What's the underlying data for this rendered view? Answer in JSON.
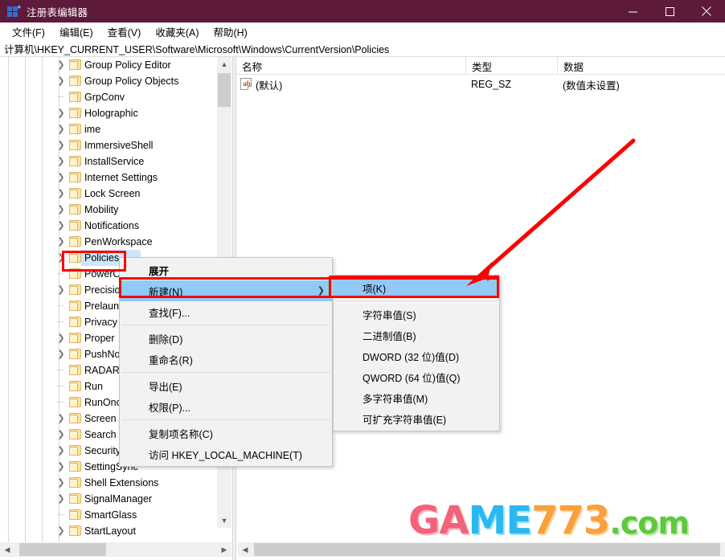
{
  "window": {
    "title": "注册表编辑器",
    "icon": "registry-editor-icon",
    "titlebar_color": "#5d1a3b",
    "minimize_label": "—",
    "maximize_label": "▢",
    "close_label": "✕"
  },
  "menubar": {
    "items": [
      {
        "label": "文件(F)"
      },
      {
        "label": "编辑(E)"
      },
      {
        "label": "查看(V)"
      },
      {
        "label": "收藏夹(A)"
      },
      {
        "label": "帮助(H)"
      }
    ]
  },
  "address": {
    "path": "计算机\\HKEY_CURRENT_USER\\Software\\Microsoft\\Windows\\CurrentVersion\\Policies"
  },
  "tree": {
    "items": [
      {
        "label": "Group Policy Editor",
        "expandable": true,
        "selected": false
      },
      {
        "label": "Group Policy Objects",
        "expandable": true,
        "selected": false
      },
      {
        "label": "GrpConv",
        "expandable": false,
        "selected": false
      },
      {
        "label": "Holographic",
        "expandable": true,
        "selected": false
      },
      {
        "label": "ime",
        "expandable": true,
        "selected": false
      },
      {
        "label": "ImmersiveShell",
        "expandable": true,
        "selected": false
      },
      {
        "label": "InstallService",
        "expandable": true,
        "selected": false
      },
      {
        "label": "Internet Settings",
        "expandable": true,
        "selected": false
      },
      {
        "label": "Lock Screen",
        "expandable": true,
        "selected": false
      },
      {
        "label": "Mobility",
        "expandable": true,
        "selected": false
      },
      {
        "label": "Notifications",
        "expandable": true,
        "selected": false
      },
      {
        "label": "PenWorkspace",
        "expandable": true,
        "selected": false
      },
      {
        "label": "Policies",
        "expandable": true,
        "selected": true
      },
      {
        "label": "PowerConfiguration",
        "expandable": false,
        "selected": false
      },
      {
        "label": "Precision Touchpad",
        "expandable": true,
        "selected": false
      },
      {
        "label": "Prelaunch",
        "expandable": false,
        "selected": false
      },
      {
        "label": "Privacy",
        "expandable": false,
        "selected": false
      },
      {
        "label": "Proper",
        "expandable": true,
        "selected": false
      },
      {
        "label": "PushNotifications",
        "expandable": true,
        "selected": false
      },
      {
        "label": "RADAR",
        "expandable": false,
        "selected": false
      },
      {
        "label": "Run",
        "expandable": false,
        "selected": false
      },
      {
        "label": "RunOnce",
        "expandable": false,
        "selected": false
      },
      {
        "label": "Screen",
        "expandable": true,
        "selected": false
      },
      {
        "label": "Search",
        "expandable": true,
        "selected": false
      },
      {
        "label": "Security and Maintenance",
        "expandable": true,
        "selected": false
      },
      {
        "label": "SettingSync",
        "expandable": true,
        "selected": false
      },
      {
        "label": "Shell Extensions",
        "expandable": true,
        "selected": false
      },
      {
        "label": "SignalManager",
        "expandable": true,
        "selected": false
      },
      {
        "label": "SmartGlass",
        "expandable": false,
        "selected": false
      },
      {
        "label": "StartLayout",
        "expandable": true,
        "selected": false
      }
    ]
  },
  "listview": {
    "columns": [
      {
        "label": "名称"
      },
      {
        "label": "类型"
      },
      {
        "label": "数据"
      }
    ],
    "rows": [
      {
        "name": "(默认)",
        "type": "REG_SZ",
        "data": "(数值未设置)",
        "icon": "string-value-icon"
      }
    ]
  },
  "context_menu": {
    "items": [
      {
        "label": "展开",
        "bold": true,
        "highlight": false,
        "submenu": false
      },
      {
        "label": "新建(N)",
        "bold": false,
        "highlight": true,
        "submenu": true
      },
      {
        "label": "查找(F)...",
        "bold": false,
        "highlight": false,
        "submenu": false
      },
      {
        "separator": true
      },
      {
        "label": "删除(D)",
        "bold": false,
        "highlight": false,
        "submenu": false
      },
      {
        "label": "重命名(R)",
        "bold": false,
        "highlight": false,
        "submenu": false
      },
      {
        "separator": true
      },
      {
        "label": "导出(E)",
        "bold": false,
        "highlight": false,
        "submenu": false
      },
      {
        "label": "权限(P)...",
        "bold": false,
        "highlight": false,
        "submenu": false
      },
      {
        "separator": true
      },
      {
        "label": "复制项名称(C)",
        "bold": false,
        "highlight": false,
        "submenu": false
      },
      {
        "label": "访问 HKEY_LOCAL_MACHINE(T)",
        "bold": false,
        "highlight": false,
        "submenu": false
      }
    ]
  },
  "submenu": {
    "items": [
      {
        "label": "项(K)",
        "highlight": true
      },
      {
        "separator": true
      },
      {
        "label": "字符串值(S)",
        "highlight": false
      },
      {
        "label": "二进制值(B)",
        "highlight": false
      },
      {
        "label": "DWORD (32 位)值(D)",
        "highlight": false
      },
      {
        "label": "QWORD (64 位)值(Q)",
        "highlight": false
      },
      {
        "label": "多字符串值(M)",
        "highlight": false
      },
      {
        "label": "可扩充字符串值(E)",
        "highlight": false
      }
    ]
  },
  "annotations": {
    "highlight_color": "#ff0000",
    "boxes": [
      {
        "name": "policies-key-callout"
      },
      {
        "name": "new-menu-callout"
      },
      {
        "name": "key-submenu-callout"
      }
    ],
    "arrow": {
      "name": "pointer-arrow",
      "from": "(785,175)",
      "to": "(582,352)"
    }
  },
  "watermark": {
    "part1": "GA",
    "part2": "ME",
    "part3": "773",
    "part4": ".com"
  }
}
